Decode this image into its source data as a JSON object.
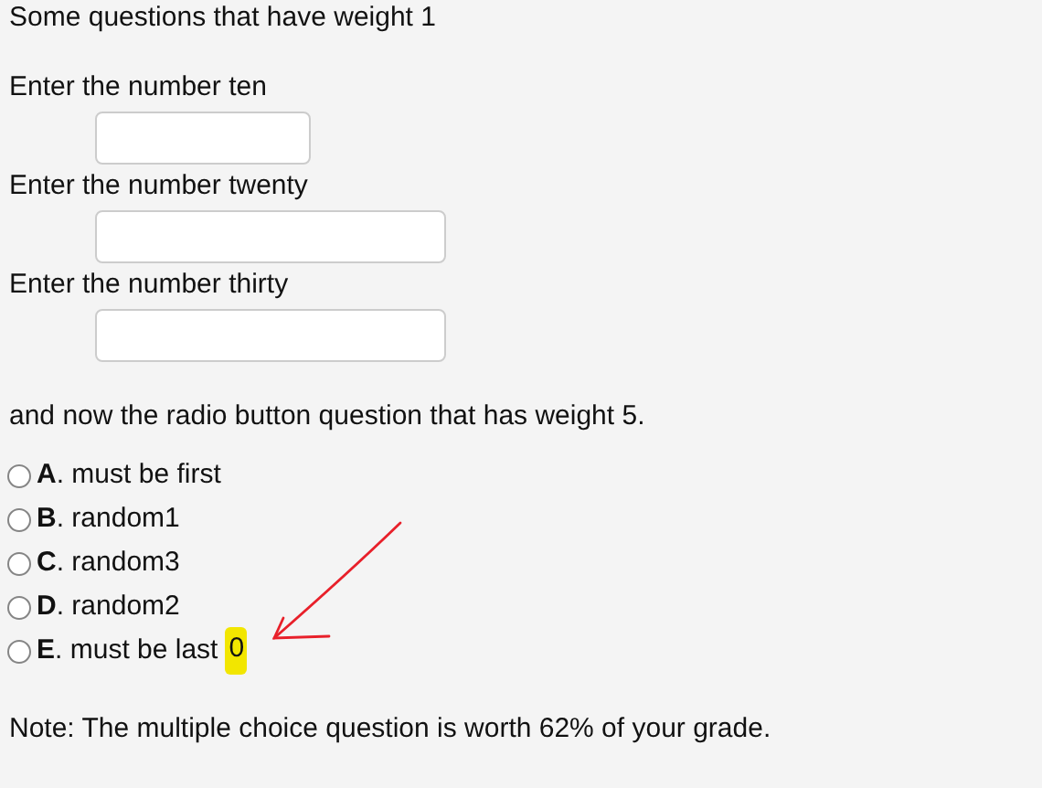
{
  "heading": "Some questions that have weight 1",
  "fields": [
    {
      "label": "Enter the number ten",
      "kind": "short"
    },
    {
      "label": "Enter the number twenty",
      "kind": "long"
    },
    {
      "label": "Enter the number thirty",
      "kind": "long"
    }
  ],
  "radio_prompt": "and now the radio button question that has weight 5.",
  "options": [
    {
      "label": "**A**. must be first",
      "selected": false
    },
    {
      "label": "**B**. random1",
      "selected": false
    },
    {
      "label": "**C**. random3",
      "selected": false
    },
    {
      "label": "**D**. random2",
      "selected": false
    },
    {
      "label": "**E**. must be last",
      "selected": false,
      "highlighted_mark": "0",
      "annotation_arrow": true
    }
  ],
  "note": "Note: The multiple choice question is worth 62% of your grade."
}
